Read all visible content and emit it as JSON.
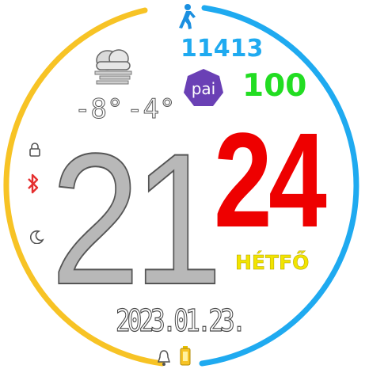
{
  "watch_face": {
    "steps": "11413",
    "pai": {
      "badge_label": "pai",
      "value": "100"
    },
    "weather": {
      "icon": "cloudy-foggy-icon",
      "temp_low": "-8°",
      "temp_high": "-4°"
    },
    "time": {
      "hour": "21",
      "minute": "24"
    },
    "weekday": "HÉTFŐ",
    "date": "2023.01.23.",
    "status_icons": [
      "lock-icon",
      "bluetooth-icon",
      "moon-icon",
      "bell-icon",
      "battery-icon"
    ],
    "colors": {
      "ring_left": "#f7c325",
      "ring_right": "#1faaf0",
      "hour": "#b8b8b8",
      "minute": "#ee0000",
      "steps": "#1faaf0",
      "pai": "#22dd22",
      "pai_badge": "#6a40b5",
      "weekday": "#f2e400",
      "bluetooth": "#e53030"
    }
  }
}
